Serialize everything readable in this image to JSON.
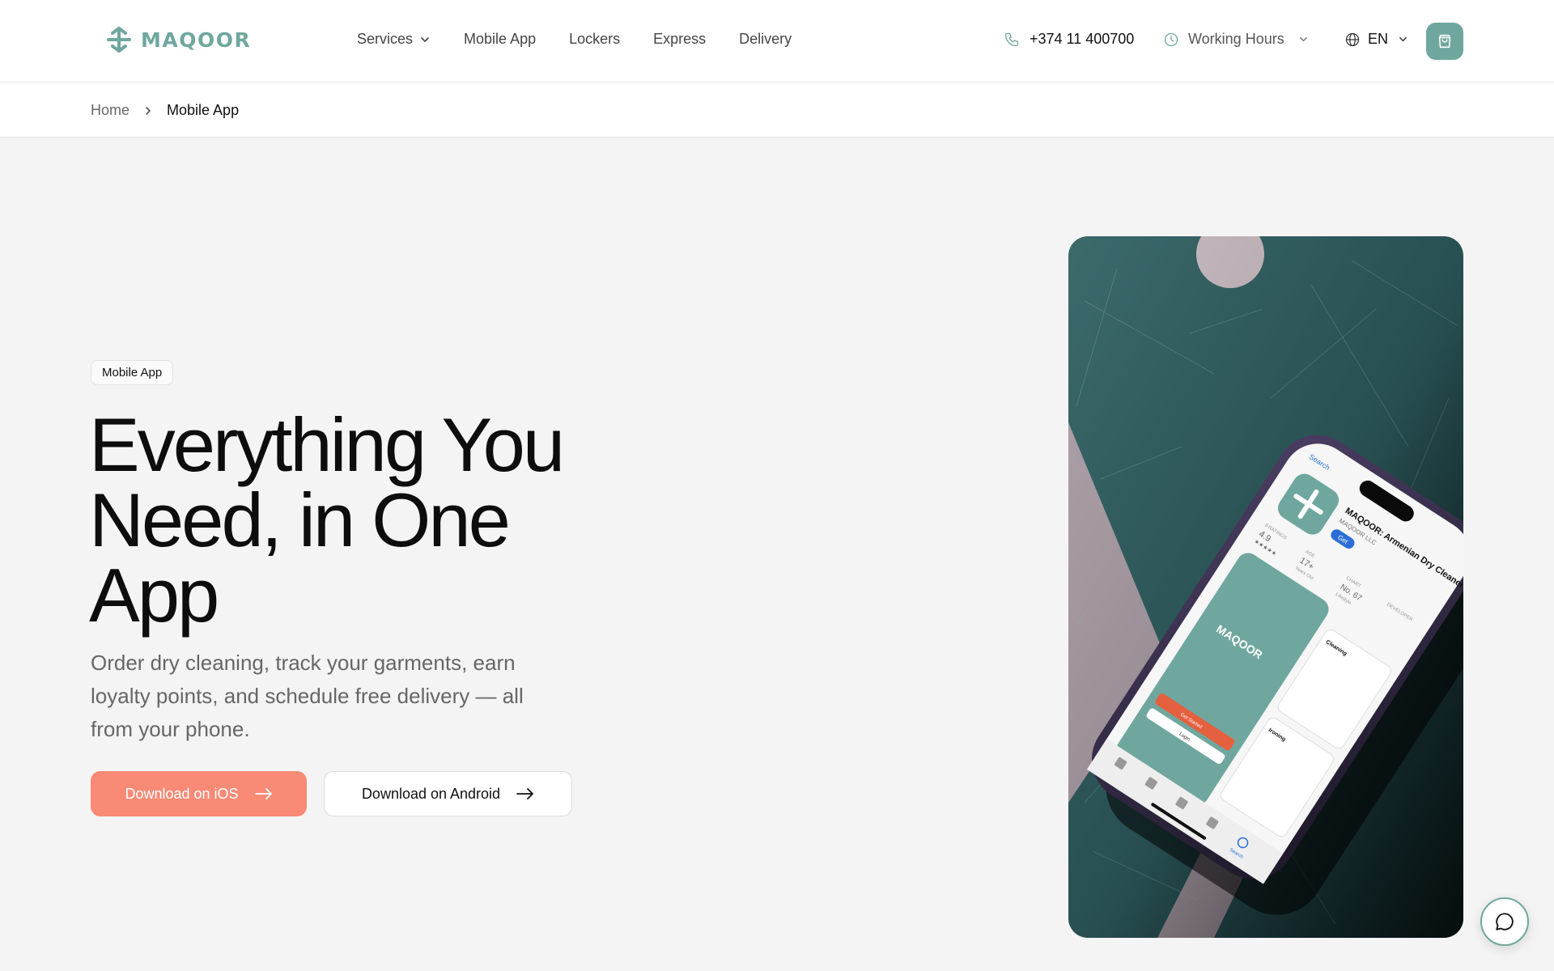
{
  "brand": {
    "logo_text": "MAQOOR",
    "accent_color": "#6fa79e",
    "cta_color": "#f88a76"
  },
  "header": {
    "nav": [
      {
        "label": "Services",
        "has_dropdown": true
      },
      {
        "label": "Mobile App",
        "has_dropdown": false
      },
      {
        "label": "Lockers",
        "has_dropdown": false
      },
      {
        "label": "Express",
        "has_dropdown": false
      },
      {
        "label": "Delivery",
        "has_dropdown": false
      }
    ],
    "phone": "+374 11 400700",
    "working_hours_label": "Working Hours",
    "language": "EN",
    "icons": {
      "phone": "phone-icon",
      "clock": "clock-icon",
      "globe": "globe-icon",
      "cart": "shopping-bag-icon"
    }
  },
  "breadcrumb": {
    "home": "Home",
    "current": "Mobile App"
  },
  "hero": {
    "badge": "Mobile App",
    "title": "Everything You Need, in One App",
    "subtitle": "Order dry cleaning, track your garments, earn loyalty points, and schedule free delivery — all from your phone.",
    "buttons": {
      "ios": "Download on iOS",
      "android": "Download on Android"
    }
  },
  "phone_mockup": {
    "app_name": "MAQOOR: Armenian Dry Cleaner",
    "developer": "MAQOOR LLC",
    "get_label": "Get",
    "back_label": "Search",
    "rating": "4.9",
    "ratings_label": "8 RATINGS",
    "age": "17+",
    "age_label": "AGE",
    "age_sub": "Years Old",
    "chart_rank": "No. 67",
    "chart_label": "CHART",
    "chart_sub": "Lifestyle",
    "dev_label": "DEVELOPER",
    "screen_logo": "MAQOOR",
    "screen_cta": "Get Started",
    "screen_login": "Login",
    "card1_title": "Cleaning",
    "card2_title": "Ironing",
    "tab_search": "Search",
    "stars": "★★★★★"
  },
  "chat": {
    "icon": "chat-bubble-icon"
  }
}
